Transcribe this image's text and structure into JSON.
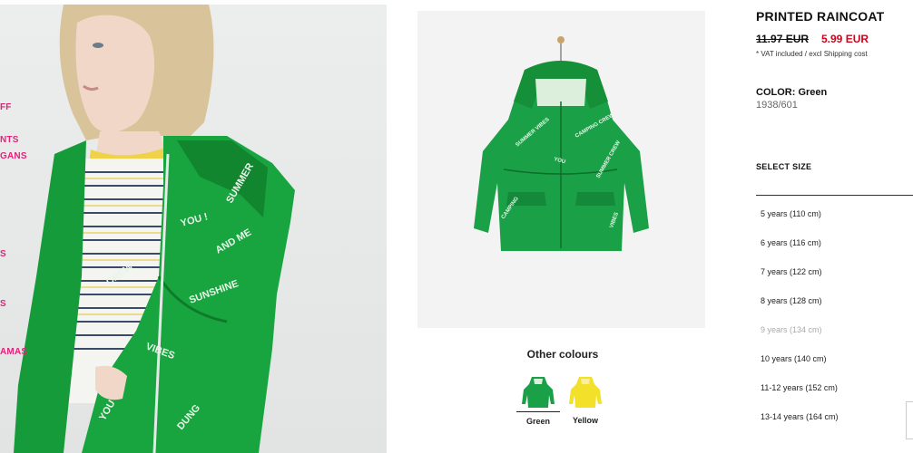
{
  "left_nav": {
    "items": [
      {
        "label": "FF"
      },
      {
        "label": "NTS"
      },
      {
        "label": "GANS"
      },
      {
        "label": "S"
      },
      {
        "label": "S"
      },
      {
        "label": "AMAS"
      }
    ]
  },
  "model_image": {
    "alt_icon": "model-photo"
  },
  "product_image": {
    "alt_icon": "raincoat-photo"
  },
  "other_colours": {
    "title": "Other colours",
    "swatches": [
      {
        "label": "Green",
        "color": "#1a9a3c",
        "selected": true
      },
      {
        "label": "Yellow",
        "color": "#f2e02b",
        "selected": false
      }
    ]
  },
  "product": {
    "title": "PRINTED RAINCOAT",
    "price_old": "11.97 EUR",
    "price_new": "5.99 EUR",
    "vat_note": "* VAT included / excl Shipping cost",
    "color_label": "COLOR: Green",
    "reference": "1938/601"
  },
  "sizes": {
    "title": "SELECT SIZE",
    "items": [
      {
        "label": "5 years (110 cm)",
        "available": true
      },
      {
        "label": "6 years (116 cm)",
        "available": true
      },
      {
        "label": "7 years (122 cm)",
        "available": true
      },
      {
        "label": "8 years (128 cm)",
        "available": true
      },
      {
        "label": "9 years (134 cm)",
        "available": false
      },
      {
        "label": "10 years (140 cm)",
        "available": true
      },
      {
        "label": "11-12 years (152 cm)",
        "available": true
      },
      {
        "label": "13-14 years (164 cm)",
        "available": true
      }
    ]
  },
  "colors": {
    "brand_pink": "#e3237a",
    "sale_red": "#d0021b",
    "coat_green": "#1a9a3c"
  }
}
